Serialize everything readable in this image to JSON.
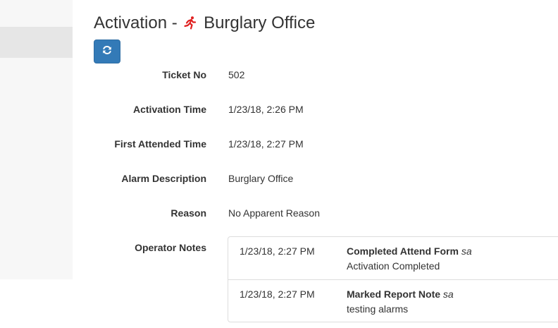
{
  "header": {
    "title_prefix": "Activation -",
    "title_name": "Burglary Office",
    "alarm_icon": "running-person-icon",
    "alarm_icon_color": "#e02020"
  },
  "toolbar": {
    "refresh_icon": "refresh-icon",
    "refresh_color": "#337ab7"
  },
  "fields": {
    "ticket_no": {
      "label": "Ticket No",
      "value": "502"
    },
    "activation_time": {
      "label": "Activation Time",
      "value": "1/23/18, 2:26 PM"
    },
    "first_attended_time": {
      "label": "First Attended Time",
      "value": "1/23/18, 2:27 PM"
    },
    "alarm_description": {
      "label": "Alarm Description",
      "value": "Burglary Office"
    },
    "reason": {
      "label": "Reason",
      "value": "No Apparent Reason"
    },
    "operator_notes": {
      "label": "Operator Notes"
    }
  },
  "notes": [
    {
      "time": "1/23/18, 2:27 PM",
      "action": "Completed Attend Form",
      "user": "sa",
      "text": "Activation Completed"
    },
    {
      "time": "1/23/18, 2:27 PM",
      "action": "Marked Report Note",
      "user": "sa",
      "text": "testing alarms"
    }
  ]
}
